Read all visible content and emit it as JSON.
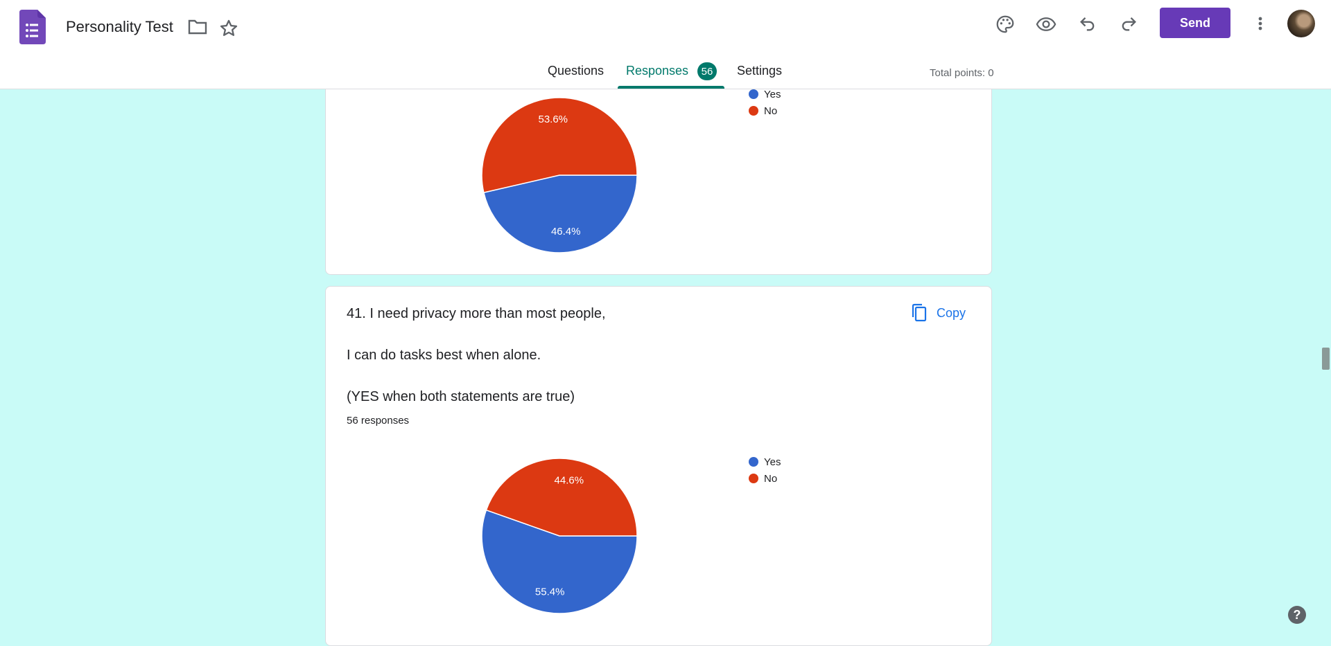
{
  "app": {
    "title": "Personality Test"
  },
  "header": {
    "send_label": "Send",
    "icons": [
      "palette-icon",
      "eye-icon",
      "undo-icon",
      "redo-icon",
      "more-vert-icon"
    ]
  },
  "tabs": [
    {
      "label": "Questions"
    },
    {
      "label": "Responses",
      "badge": "56"
    },
    {
      "label": "Settings"
    }
  ],
  "total_points": "Total points: 0",
  "colors": {
    "yes": "#3366cc",
    "no": "#dc3912",
    "accent": "#673ab7",
    "tab_active": "#00796b",
    "page_bg": "#c9fbf7"
  },
  "cards": [
    {
      "legend": [
        {
          "label": "Yes"
        },
        {
          "label": "No"
        }
      ],
      "chart_data": {
        "type": "pie",
        "categories": [
          "Yes",
          "No"
        ],
        "values": [
          46.4,
          53.6
        ],
        "labels": [
          "46.4%",
          "53.6%"
        ]
      }
    },
    {
      "question_lines": [
        "41. I need privacy more than most people,",
        "I can do tasks best when alone.",
        "(YES when both statements are true)"
      ],
      "responses": "56 responses",
      "copy_label": "Copy",
      "legend": [
        {
          "label": "Yes"
        },
        {
          "label": "No"
        }
      ],
      "chart_data": {
        "type": "pie",
        "categories": [
          "Yes",
          "No"
        ],
        "values": [
          55.4,
          44.6
        ],
        "labels": [
          "55.4%",
          "44.6%"
        ]
      }
    }
  ],
  "help": "?"
}
